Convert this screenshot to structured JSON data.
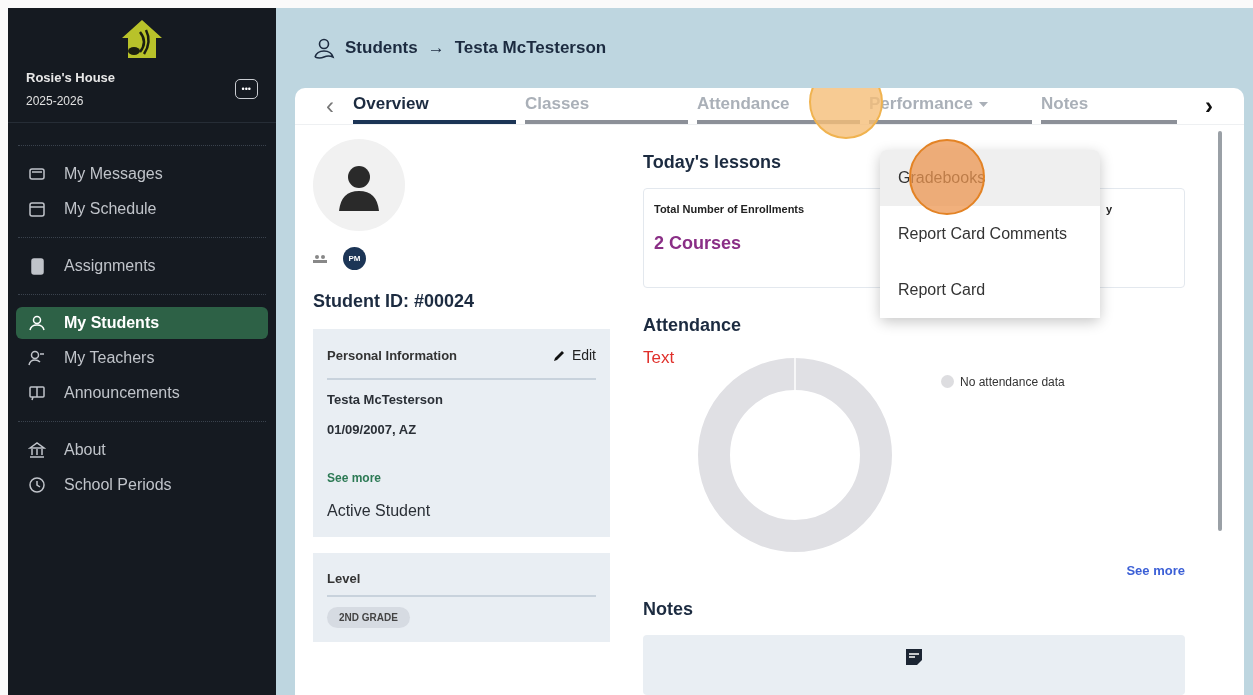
{
  "sidebar": {
    "school": "Rosie's House",
    "year": "2025-2026",
    "more_button": "•••",
    "groups": [
      [
        {
          "label": "My Messages",
          "selected": false
        },
        {
          "label": "My Schedule",
          "selected": false
        }
      ],
      [
        {
          "label": "Assignments",
          "selected": false
        }
      ],
      [
        {
          "label": "My Students",
          "selected": true
        },
        {
          "label": "My Teachers",
          "selected": false
        },
        {
          "label": "Announcements",
          "selected": false
        }
      ],
      [
        {
          "label": "About",
          "selected": false
        },
        {
          "label": "School Periods",
          "selected": false
        }
      ]
    ]
  },
  "breadcrumb": {
    "parent": "Students",
    "arrow": "→",
    "current": "Testa McTesterson"
  },
  "tabs": [
    {
      "label": "Overview",
      "selected": true,
      "has_menu": false
    },
    {
      "label": "Classes",
      "selected": false,
      "has_menu": false
    },
    {
      "label": "Attendance",
      "selected": false,
      "has_menu": false
    },
    {
      "label": "Performance",
      "selected": false,
      "has_menu": true
    },
    {
      "label": "Notes",
      "selected": false,
      "has_menu": false
    }
  ],
  "tab_prev": "‹",
  "tab_next": "›",
  "menu": {
    "items": [
      {
        "label": "Gradebooks",
        "selected": true
      },
      {
        "label": "Report Card Comments",
        "selected": false
      },
      {
        "label": "Report Card",
        "selected": false
      }
    ]
  },
  "student": {
    "initials": "PM",
    "student_id": "Student ID: #00024",
    "personal": {
      "title": "Personal Information",
      "edit": "Edit",
      "name": "Testa McTesterson",
      "birth": "01/09/2007, AZ",
      "see_more": "See more",
      "status": "Active Student"
    },
    "level": {
      "title": "Level",
      "value": "2ND GRADE"
    }
  },
  "lessons": {
    "title": "Today's lessons",
    "cards": [
      {
        "title": "Total Number of Enrollments",
        "value": "2 Courses"
      },
      {
        "title": "y"
      }
    ]
  },
  "attendance": {
    "title": "Attendance",
    "annotation": "Text",
    "legend": "No attendance data",
    "see_more": "See more"
  },
  "notes": {
    "title": "Notes"
  }
}
